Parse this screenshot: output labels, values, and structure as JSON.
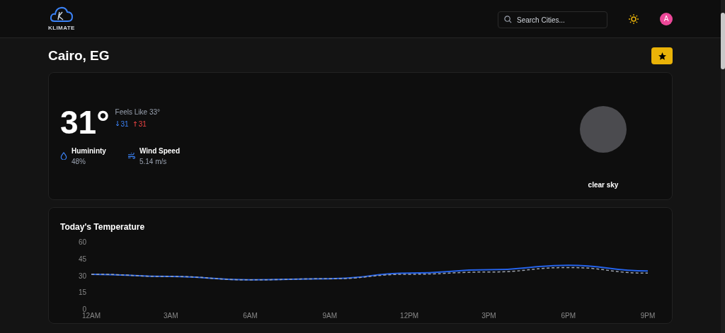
{
  "header": {
    "logo_text": "KLIMATE",
    "search": {
      "placeholder": "Search Cities..."
    },
    "avatar": "A"
  },
  "city": {
    "name": "Cairo, EG",
    "favorite": true
  },
  "current": {
    "temperature": "31°",
    "feels_like": "Feels Like 33°",
    "min": "31",
    "max": "31",
    "details": [
      {
        "kind": "humidity",
        "label": "Humininty",
        "value": "48%"
      },
      {
        "kind": "wind",
        "label": "Wind Speed",
        "value": "5.14 m/s"
      }
    ],
    "description": "clear sky"
  },
  "chart": {
    "title": "Today's Temperature",
    "chart_data": {
      "type": "line",
      "categories": [
        "12AM",
        "3AM",
        "6AM",
        "9AM",
        "12PM",
        "3PM",
        "6PM",
        "9PM"
      ],
      "series": [
        {
          "color": "#2563eb",
          "values": [
            31,
            29,
            26,
            27,
            32,
            35,
            39,
            34
          ]
        },
        {
          "color": "#9ca3af",
          "line_style": "dashed",
          "values": [
            31,
            29,
            26,
            27,
            31,
            33,
            37,
            32
          ]
        }
      ],
      "ylim": [
        0,
        60
      ],
      "yticks": [
        0,
        15,
        30,
        45,
        60
      ]
    }
  }
}
